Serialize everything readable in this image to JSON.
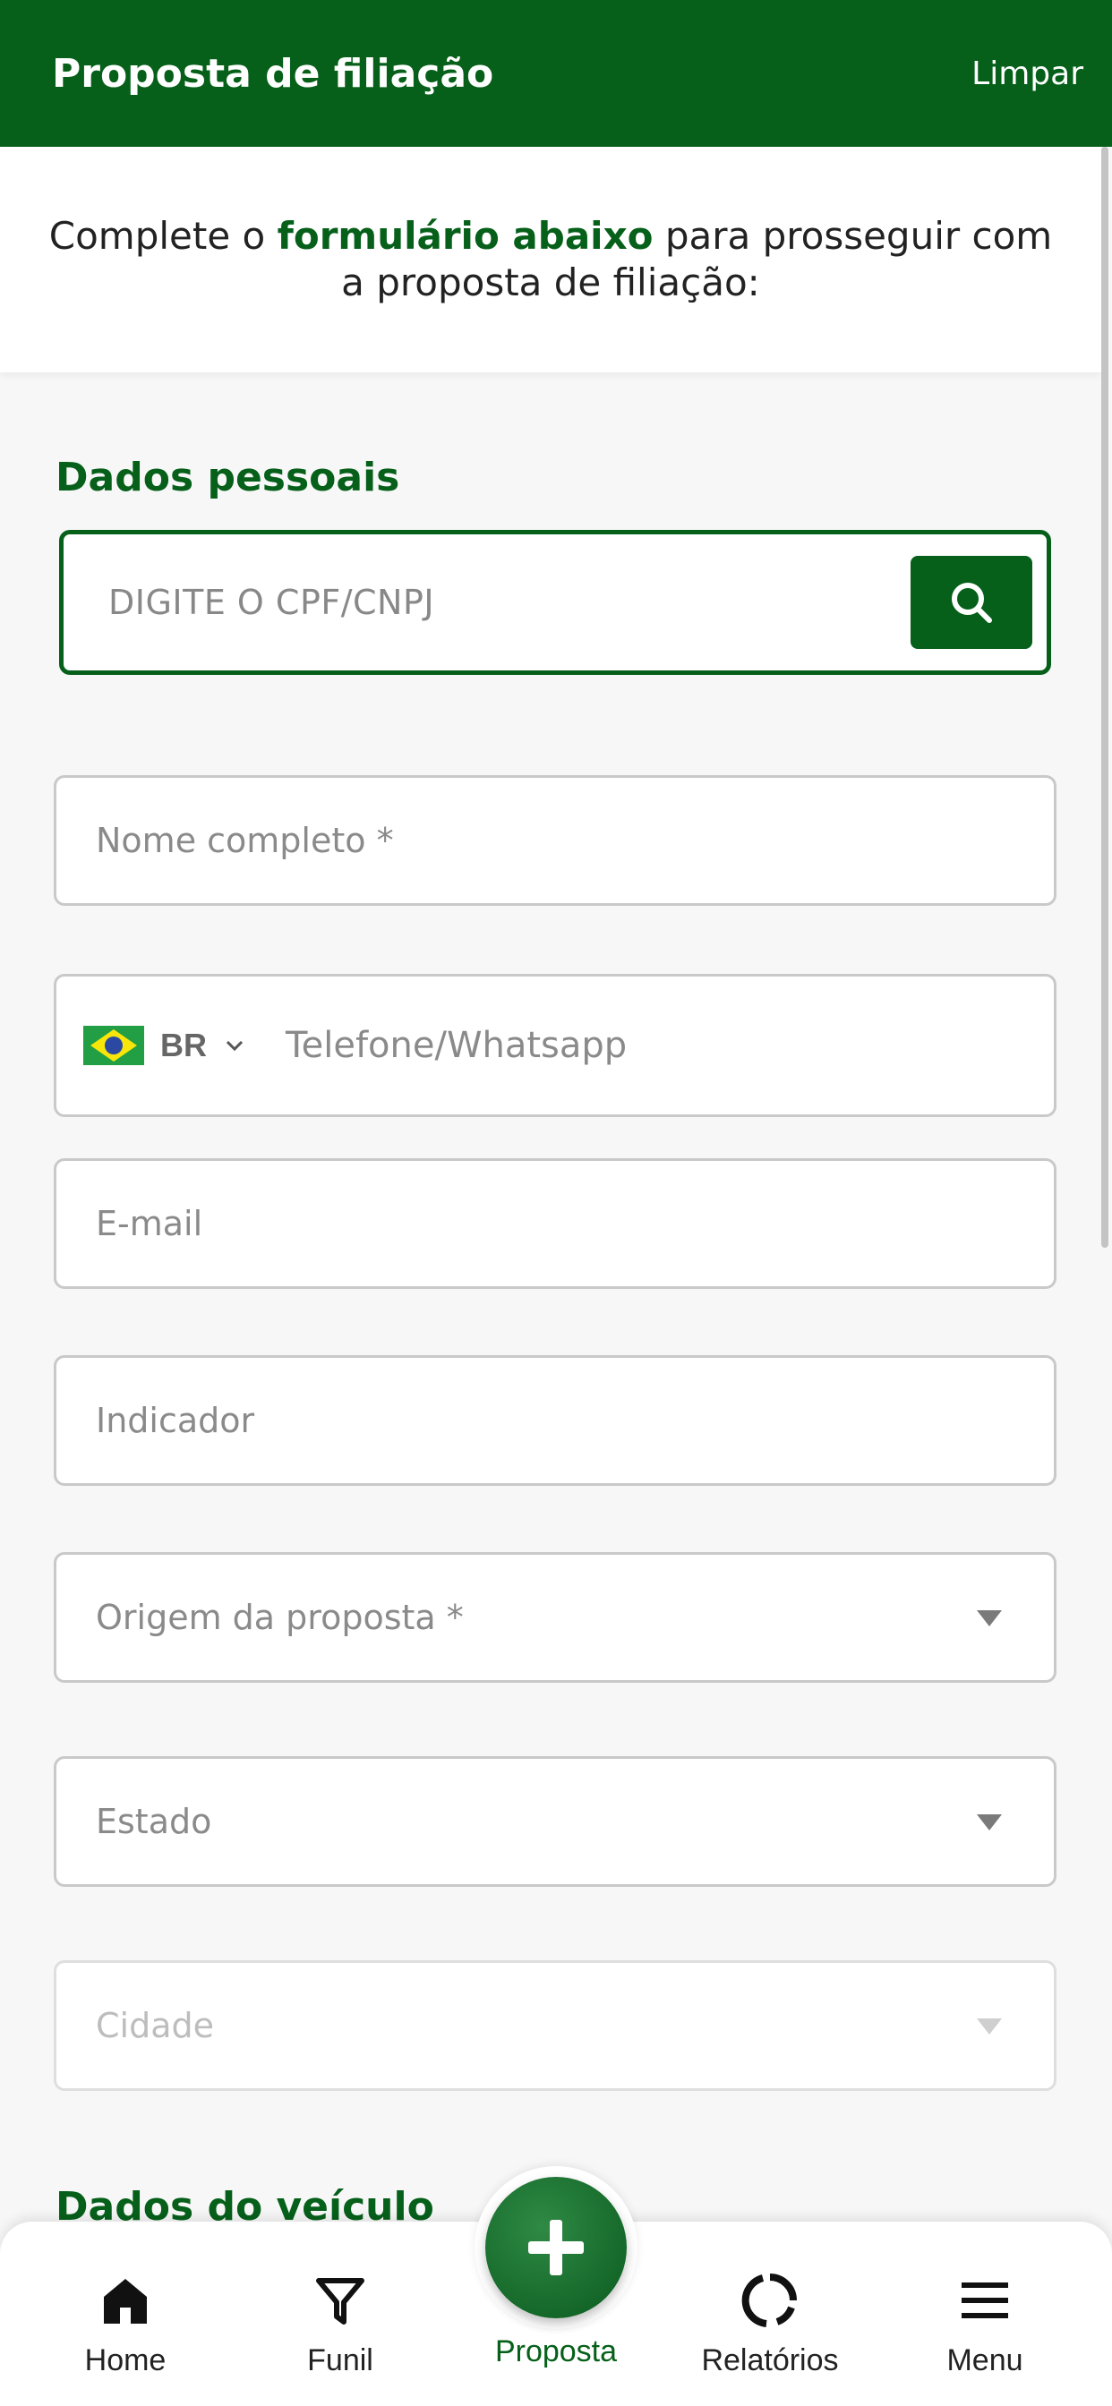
{
  "header": {
    "title": "Proposta de filiação",
    "clear_label": "Limpar"
  },
  "intro": {
    "prefix": "Complete o ",
    "highlight": "formulário abaixo",
    "suffix": " para prosseguir com a proposta de filiação:"
  },
  "personal": {
    "section_title": "Dados pessoais",
    "cpf_placeholder": "DIGITE O CPF/CNPJ",
    "name_placeholder": "Nome completo *",
    "phone": {
      "country_code": "BR",
      "placeholder": "Telefone/Whatsapp"
    },
    "email_placeholder": "E-mail",
    "indicator_placeholder": "Indicador",
    "origin_placeholder": "Origem da proposta *",
    "state_placeholder": "Estado",
    "city_placeholder": "Cidade"
  },
  "vehicle": {
    "section_title": "Dados do veículo"
  },
  "nav": {
    "home": "Home",
    "funnel": "Funil",
    "proposal": "Proposta",
    "reports": "Relatórios",
    "menu": "Menu"
  },
  "colors": {
    "brand": "#06601a",
    "placeholder": "#8a8a8a",
    "border": "#c9c9c9"
  }
}
